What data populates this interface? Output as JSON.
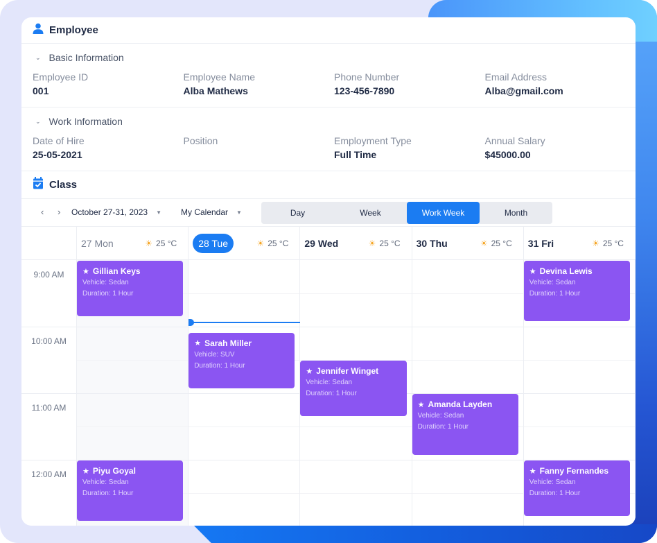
{
  "employee": {
    "title": "Employee",
    "basic": {
      "heading": "Basic Information",
      "fields": [
        {
          "label": "Employee ID",
          "value": "001"
        },
        {
          "label": "Employee Name",
          "value": "Alba Mathews"
        },
        {
          "label": "Phone Number",
          "value": "123-456-7890"
        },
        {
          "label": "Email Address",
          "value": "Alba@gmail.com"
        }
      ]
    },
    "work": {
      "heading": "Work Information",
      "fields": [
        {
          "label": "Date of Hire",
          "value": "25-05-2021"
        },
        {
          "label": "Position",
          "value": ""
        },
        {
          "label": "Employment Type",
          "value": "Full Time"
        },
        {
          "label": "Annual Salary",
          "value": "$45000.00"
        }
      ]
    }
  },
  "class": {
    "title": "Class",
    "toolbar": {
      "prev_icon": "chevron-left-icon",
      "next_icon": "chevron-right-icon",
      "date_range": "October 27-31, 2023",
      "calendar": "My Calendar",
      "views": [
        "Day",
        "Week",
        "Work Week",
        "Month"
      ],
      "active_view": "Work Week"
    },
    "days": [
      {
        "label": "27 Mon",
        "weather": "25 °C",
        "state": "past"
      },
      {
        "label": "28 Tue",
        "weather": "25 °C",
        "state": "today"
      },
      {
        "label": "29 Wed",
        "weather": "25 °C",
        "state": "future"
      },
      {
        "label": "30 Thu",
        "weather": "25 °C",
        "state": "future"
      },
      {
        "label": "31 Fri",
        "weather": "25 °C",
        "state": "future"
      }
    ],
    "times": [
      "9:00 AM",
      "10:00 AM",
      "11:00 AM",
      "12:00 AM"
    ],
    "events": [
      {
        "name": "Gillian Keys",
        "vehicle": "Vehicle: Sedan",
        "duration": "Duration: 1 Hour",
        "day": 0,
        "start_hour": 0.0
      },
      {
        "name": "Devina Lewis",
        "vehicle": "Vehicle: Sedan",
        "duration": "Duration: 1 Hour",
        "day": 4,
        "start_hour": 0.0
      },
      {
        "name": "Sarah Miller",
        "vehicle": "Vehicle: SUV",
        "duration": "Duration: 1 Hour",
        "day": 1,
        "start_hour": 1.08
      },
      {
        "name": "Jennifer Winget",
        "vehicle": "Vehicle: Sedan",
        "duration": "Duration: 1 Hour",
        "day": 2,
        "start_hour": 1.5
      },
      {
        "name": "Amanda Layden",
        "vehicle": "Vehicle: Sedan",
        "duration": "Duration: 1 Hour",
        "day": 3,
        "start_hour": 2.0
      },
      {
        "name": "Piyu Goyal",
        "vehicle": "Vehicle: Sedan",
        "duration": "Duration: 1 Hour",
        "day": 0,
        "start_hour": 3.0
      },
      {
        "name": "Fanny Fernandes",
        "vehicle": "Vehicle: Sedan",
        "duration": "Duration: 1 Hour",
        "day": 4,
        "start_hour": 3.0
      }
    ],
    "current_time_hour": 0.93
  },
  "colors": {
    "accent": "#1b7cf2",
    "event": "#8b55f2",
    "weather_icon": "#f5a524"
  }
}
